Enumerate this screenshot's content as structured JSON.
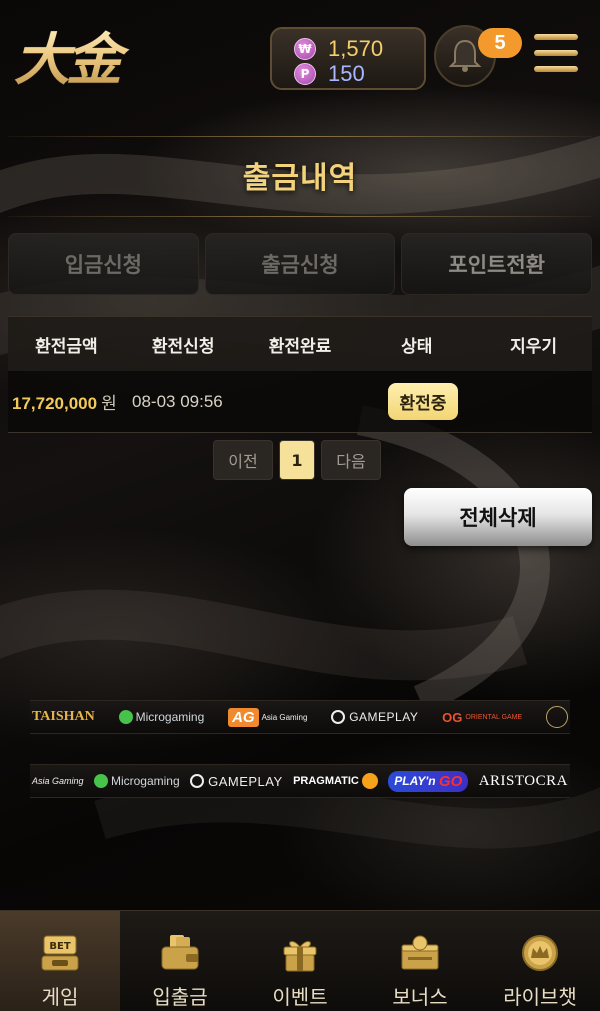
{
  "header": {
    "logo_text": "大金",
    "wallet": {
      "won_symbol": "₩",
      "won_value": "1,570",
      "point_symbol": "P",
      "point_value": "150"
    },
    "notification_count": "5"
  },
  "page_title": "출금내역",
  "tabs": [
    {
      "label": "입금신청"
    },
    {
      "label": "출금신청"
    },
    {
      "label": "포인트전환"
    }
  ],
  "table": {
    "headers": [
      "환전금액",
      "환전신청",
      "환전완료",
      "상태",
      "지우기"
    ],
    "rows": [
      {
        "amount": "17,720,000",
        "unit": "원",
        "requested": "08-03 09:56",
        "completed": "",
        "status": "환전중"
      }
    ]
  },
  "pagination": {
    "prev": "이전",
    "current": "1",
    "next": "다음"
  },
  "delete_all_label": "전체삭제",
  "providers_row1": {
    "taishan": "TAISHAN",
    "microgaming": "Microgaming",
    "ag": "AG",
    "ag_sub": "Asia Gaming",
    "gameplay": "GAMEPLAY",
    "og": "OG",
    "og_sub": "ORIENTAL GAME"
  },
  "providers_row2": {
    "asia": "Asia Gaming",
    "microgaming": "Microgaming",
    "gameplay": "GAMEPLAY",
    "pragmatic": "PRAGMATIC",
    "playngo_a": "PLAY'n",
    "playngo_b": "GO",
    "aristocrat": "ARISTOCRA"
  },
  "bottom_nav": [
    {
      "label": "게임",
      "icon": "bet-slot-icon"
    },
    {
      "label": "입출금",
      "icon": "wallet-icon"
    },
    {
      "label": "이벤트",
      "icon": "gift-icon"
    },
    {
      "label": "보너스",
      "icon": "bonus-box-icon"
    },
    {
      "label": "라이브챗",
      "icon": "crown-chat-icon"
    }
  ],
  "colors": {
    "gold": "#f3d27c",
    "accent_orange": "#f49a2c",
    "status_badge": "#f2d574"
  }
}
